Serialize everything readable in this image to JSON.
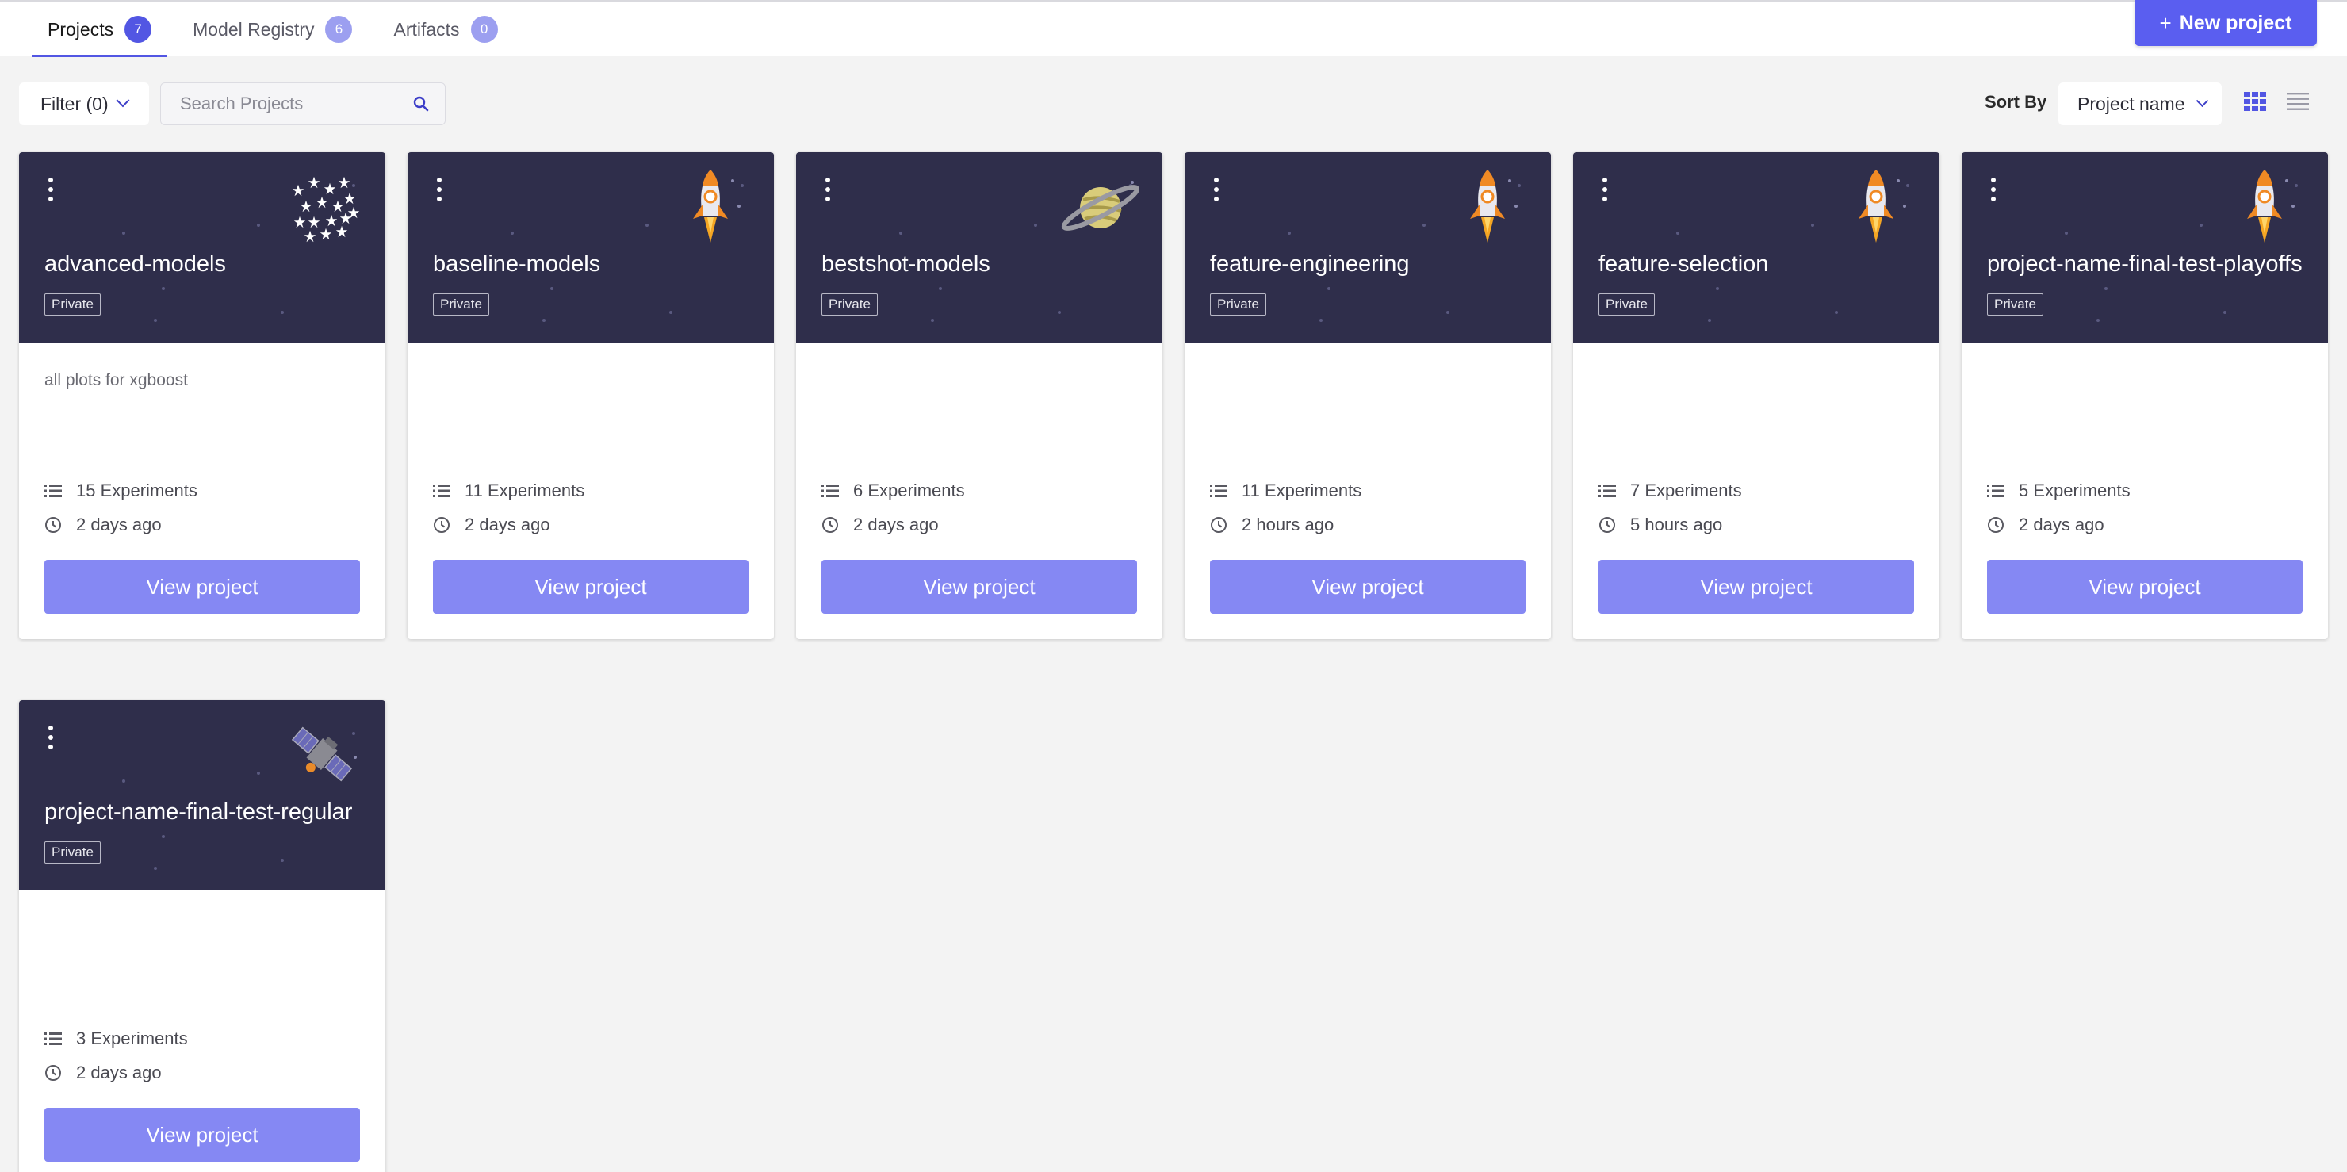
{
  "tabs": [
    {
      "label": "Projects",
      "count": "7",
      "active": true
    },
    {
      "label": "Model Registry",
      "count": "6",
      "active": false
    },
    {
      "label": "Artifacts",
      "count": "0",
      "active": false
    }
  ],
  "actions": {
    "new_project_label": "New project",
    "new_project_icon": "plus-icon"
  },
  "toolbar": {
    "filter_label": "Filter",
    "filter_count": "(0)",
    "search_placeholder": "Search Projects",
    "search_value": "",
    "sort_label": "Sort By",
    "sort_value": "Project name"
  },
  "colors": {
    "accent": "#5256e3",
    "card_header": "#2f2e4b",
    "view_button": "#8588f3"
  },
  "projects": [
    {
      "name": "advanced-models",
      "visibility": "Private",
      "description": "all plots for xgboost",
      "experiments": "15 Experiments",
      "updated": "2 days ago",
      "button": "View project",
      "illustration": "stars-icon"
    },
    {
      "name": "baseline-models",
      "visibility": "Private",
      "description": "",
      "experiments": "11 Experiments",
      "updated": "2 days ago",
      "button": "View project",
      "illustration": "rocket-icon"
    },
    {
      "name": "bestshot-models",
      "visibility": "Private",
      "description": "",
      "experiments": "6 Experiments",
      "updated": "2 days ago",
      "button": "View project",
      "illustration": "planet-icon"
    },
    {
      "name": "feature-engineering",
      "visibility": "Private",
      "description": "",
      "experiments": "11 Experiments",
      "updated": "2 hours ago",
      "button": "View project",
      "illustration": "rocket-icon"
    },
    {
      "name": "feature-selection",
      "visibility": "Private",
      "description": "",
      "experiments": "7 Experiments",
      "updated": "5 hours ago",
      "button": "View project",
      "illustration": "rocket-icon"
    },
    {
      "name": "project-name-final-test-playoffs",
      "visibility": "Private",
      "description": "",
      "experiments": "5 Experiments",
      "updated": "2 days ago",
      "button": "View project",
      "illustration": "rocket-icon"
    },
    {
      "name": "project-name-final-test-regular",
      "visibility": "Private",
      "description": "",
      "experiments": "3 Experiments",
      "updated": "2 days ago",
      "button": "View project",
      "illustration": "satellite-icon"
    }
  ]
}
